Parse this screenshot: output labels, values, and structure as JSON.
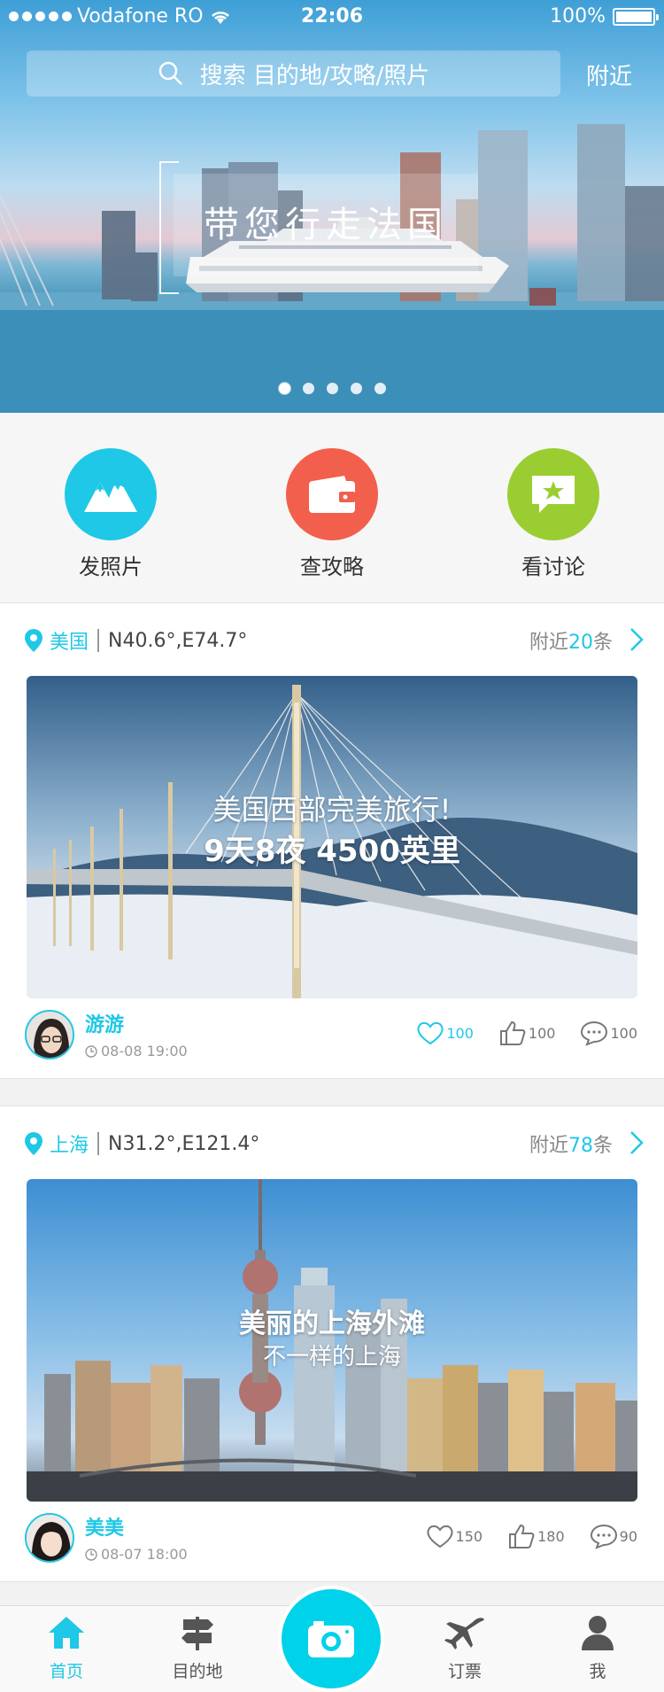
{
  "status_bar": {
    "carrier": "Vodafone RO",
    "time": "22:06",
    "battery": "100%"
  },
  "header": {
    "search_placeholder": "搜索 目的地/攻略/照片",
    "nearby_label": "附近"
  },
  "banner": {
    "title": "带您行走法国",
    "page_count": 5,
    "active_page": 1
  },
  "quick_actions": [
    {
      "label": "发照片",
      "color": "#1ec8e6",
      "icon": "mountain-icon"
    },
    {
      "label": "查攻略",
      "color": "#f25f4c",
      "icon": "wallet-icon"
    },
    {
      "label": "看讨论",
      "color": "#9acd32",
      "icon": "chat-star-icon"
    }
  ],
  "posts": [
    {
      "location": "美国",
      "coords": "N40.6°,E74.7°",
      "nearby_prefix": "附近",
      "nearby_count": "20",
      "nearby_suffix": "条",
      "caption_line1": "美国西部完美旅行!",
      "caption_line2": "9天8夜 4500英里",
      "author_name": "游游",
      "post_time": "08-08 19:00",
      "favorites": "100",
      "likes": "100",
      "comments": "100"
    },
    {
      "location": "上海",
      "coords": "N31.2°,E121.4°",
      "nearby_prefix": "附近",
      "nearby_count": "78",
      "nearby_suffix": "条",
      "caption_line1": "美丽的上海外滩",
      "caption_line2": "不一样的上海",
      "author_name": "美美",
      "post_time": "08-07 18:00",
      "favorites": "150",
      "likes": "180",
      "comments": "90"
    }
  ],
  "tab_bar": {
    "tabs": [
      {
        "label": "首页",
        "icon": "home-icon",
        "active": true
      },
      {
        "label": "目的地",
        "icon": "signpost-icon",
        "active": false
      },
      {
        "label": "订票",
        "icon": "airplane-icon",
        "active": false
      },
      {
        "label": "我",
        "icon": "person-icon",
        "active": false
      }
    ],
    "center_icon": "camera-icon"
  },
  "colors": {
    "accent": "#1ec8e6",
    "camera_button": "#00d2ea"
  }
}
